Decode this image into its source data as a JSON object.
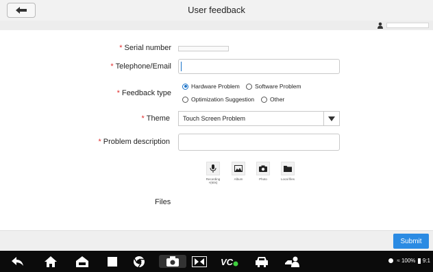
{
  "header": {
    "title": "User feedback"
  },
  "form": {
    "serial_label": "Serial number",
    "contact_label": "Telephone/Email",
    "feedback_type_label": "Feedback type",
    "feedback_options": [
      {
        "label": "Hardware Problem",
        "selected": true
      },
      {
        "label": "Software Problem",
        "selected": false
      },
      {
        "label": "Optimization Suggestion",
        "selected": false
      },
      {
        "label": "Other",
        "selected": false
      }
    ],
    "theme_label": "Theme",
    "theme_value": "Touch Screen Problem",
    "problem_label": "Problem description",
    "required_mark": "*",
    "media": [
      {
        "icon": "microphone-icon",
        "label": "Recording\n×(60s)"
      },
      {
        "icon": "album-icon",
        "label": "Album"
      },
      {
        "icon": "camera-icon",
        "label": "Photo"
      },
      {
        "icon": "folder-icon",
        "label": "Local files"
      }
    ],
    "files_label": "Files"
  },
  "footer": {
    "submit_label": "Submit"
  },
  "taskbar": {
    "icons": [
      "back-icon",
      "home-icon",
      "vehicle-home-icon",
      "recent-apps-icon",
      "browser-icon",
      "screenshot-icon",
      "screen-record-icon",
      "vci-icon",
      "car-icon",
      "user-icon"
    ],
    "status_text": "100%",
    "time_text": "9:1"
  },
  "colors": {
    "accent": "#2b8be3",
    "required": "#e02b2b",
    "taskbar": "#0b0b0b"
  }
}
